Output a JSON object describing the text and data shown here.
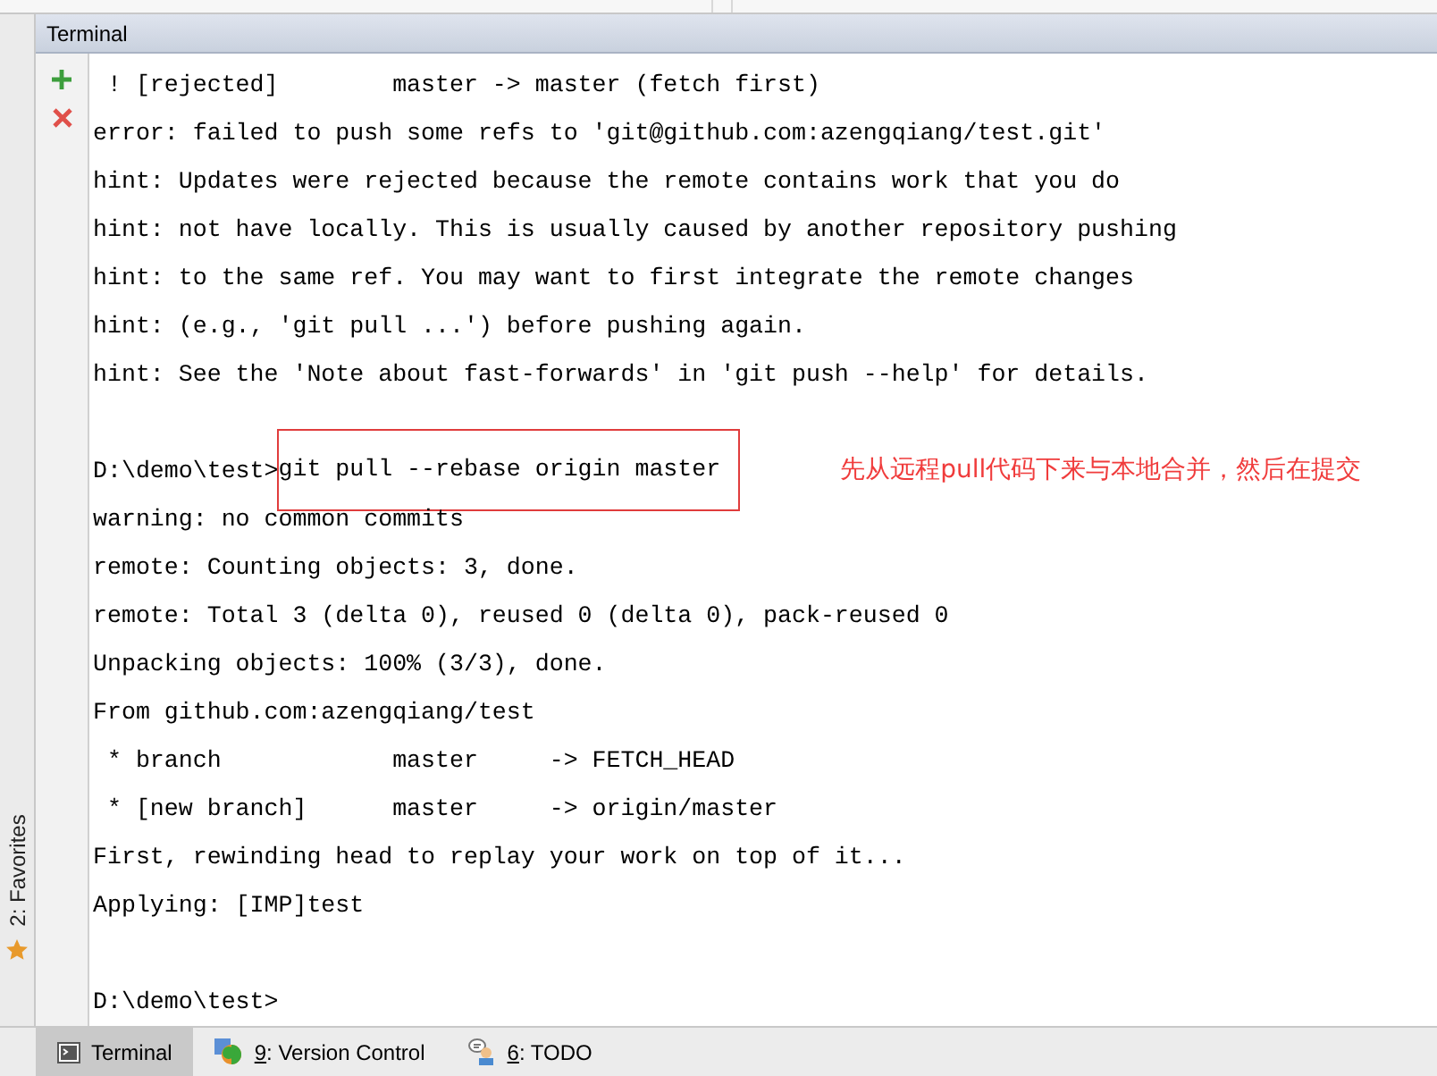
{
  "panel": {
    "title": "Terminal"
  },
  "side_tool": {
    "label": "2: Favorites"
  },
  "lines": [
    {
      "kind": "output",
      "text": " ! [rejected]        master -> master (fetch first)"
    },
    {
      "kind": "output",
      "text": "error: failed to push some refs to 'git@github.com:azengqiang/test.git'"
    },
    {
      "kind": "output",
      "text": "hint: Updates were rejected because the remote contains work that you do"
    },
    {
      "kind": "output",
      "text": "hint: not have locally. This is usually caused by another repository pushing"
    },
    {
      "kind": "output",
      "text": "hint: to the same ref. You may want to first integrate the remote changes"
    },
    {
      "kind": "output",
      "text": "hint: (e.g., 'git pull ...') before pushing again."
    },
    {
      "kind": "output",
      "text": "hint: See the 'Note about fast-forwards' in 'git push --help' for details."
    },
    {
      "kind": "command",
      "blank_before": true,
      "prompt": "D:\\demo\\test>",
      "command": "git pull --rebase origin master",
      "highlighted": true,
      "annotation": "先从远程pull代码下来与本地合并，然后在提交"
    },
    {
      "kind": "output",
      "text": "warning: no common commits"
    },
    {
      "kind": "output",
      "text": "remote: Counting objects: 3, done."
    },
    {
      "kind": "output",
      "text": "remote: Total 3 (delta 0), reused 0 (delta 0), pack-reused 0"
    },
    {
      "kind": "output",
      "text": "Unpacking objects: 100% (3/3), done."
    },
    {
      "kind": "output",
      "text": "From github.com:azengqiang/test"
    },
    {
      "kind": "output",
      "text": " * branch            master     -> FETCH_HEAD"
    },
    {
      "kind": "output",
      "text": " * [new branch]      master     -> origin/master"
    },
    {
      "kind": "output",
      "text": "First, rewinding head to replay your work on top of it..."
    },
    {
      "kind": "output",
      "text": "Applying: [IMP]test"
    },
    {
      "kind": "command",
      "blank_before": true,
      "prompt": "D:\\demo\\test>"
    }
  ],
  "bottom_tabs": [
    {
      "kind": "terminal",
      "label": "Terminal",
      "selected": true
    },
    {
      "kind": "vcs",
      "label": "9: Version Control",
      "selected": false
    },
    {
      "kind": "todo",
      "label": "6: TODO",
      "selected": false
    }
  ]
}
